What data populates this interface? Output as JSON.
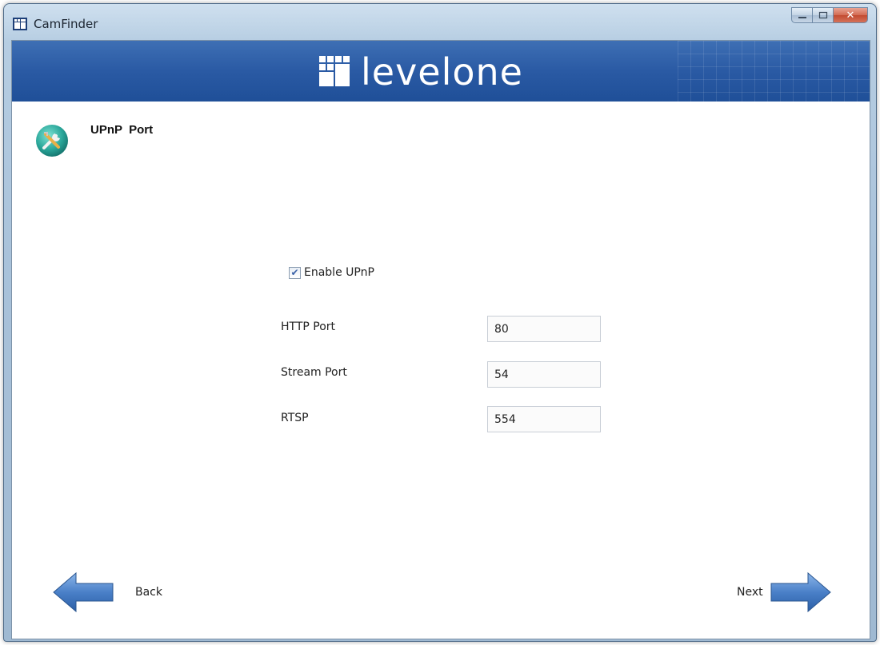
{
  "window": {
    "title": "CamFinder"
  },
  "banner": {
    "brand": "levelone"
  },
  "page": {
    "title": "UPnP  Port"
  },
  "upnp": {
    "enable_label": "Enable UPnP",
    "enabled": true
  },
  "fields": [
    {
      "label": "HTTP Port",
      "value": "80"
    },
    {
      "label": "Stream Port",
      "value": "54"
    },
    {
      "label": "RTSP",
      "value": "554"
    }
  ],
  "nav": {
    "back_label": "Back",
    "next_label": "Next"
  },
  "colors": {
    "banner": "#2a5aa4",
    "arrow": "#4a80c8",
    "titlebar": "#b6cde2"
  },
  "icons": {
    "app": "levelone-logo-icon",
    "page": "tools-icon",
    "back": "arrow-left-icon",
    "next": "arrow-right-icon"
  }
}
